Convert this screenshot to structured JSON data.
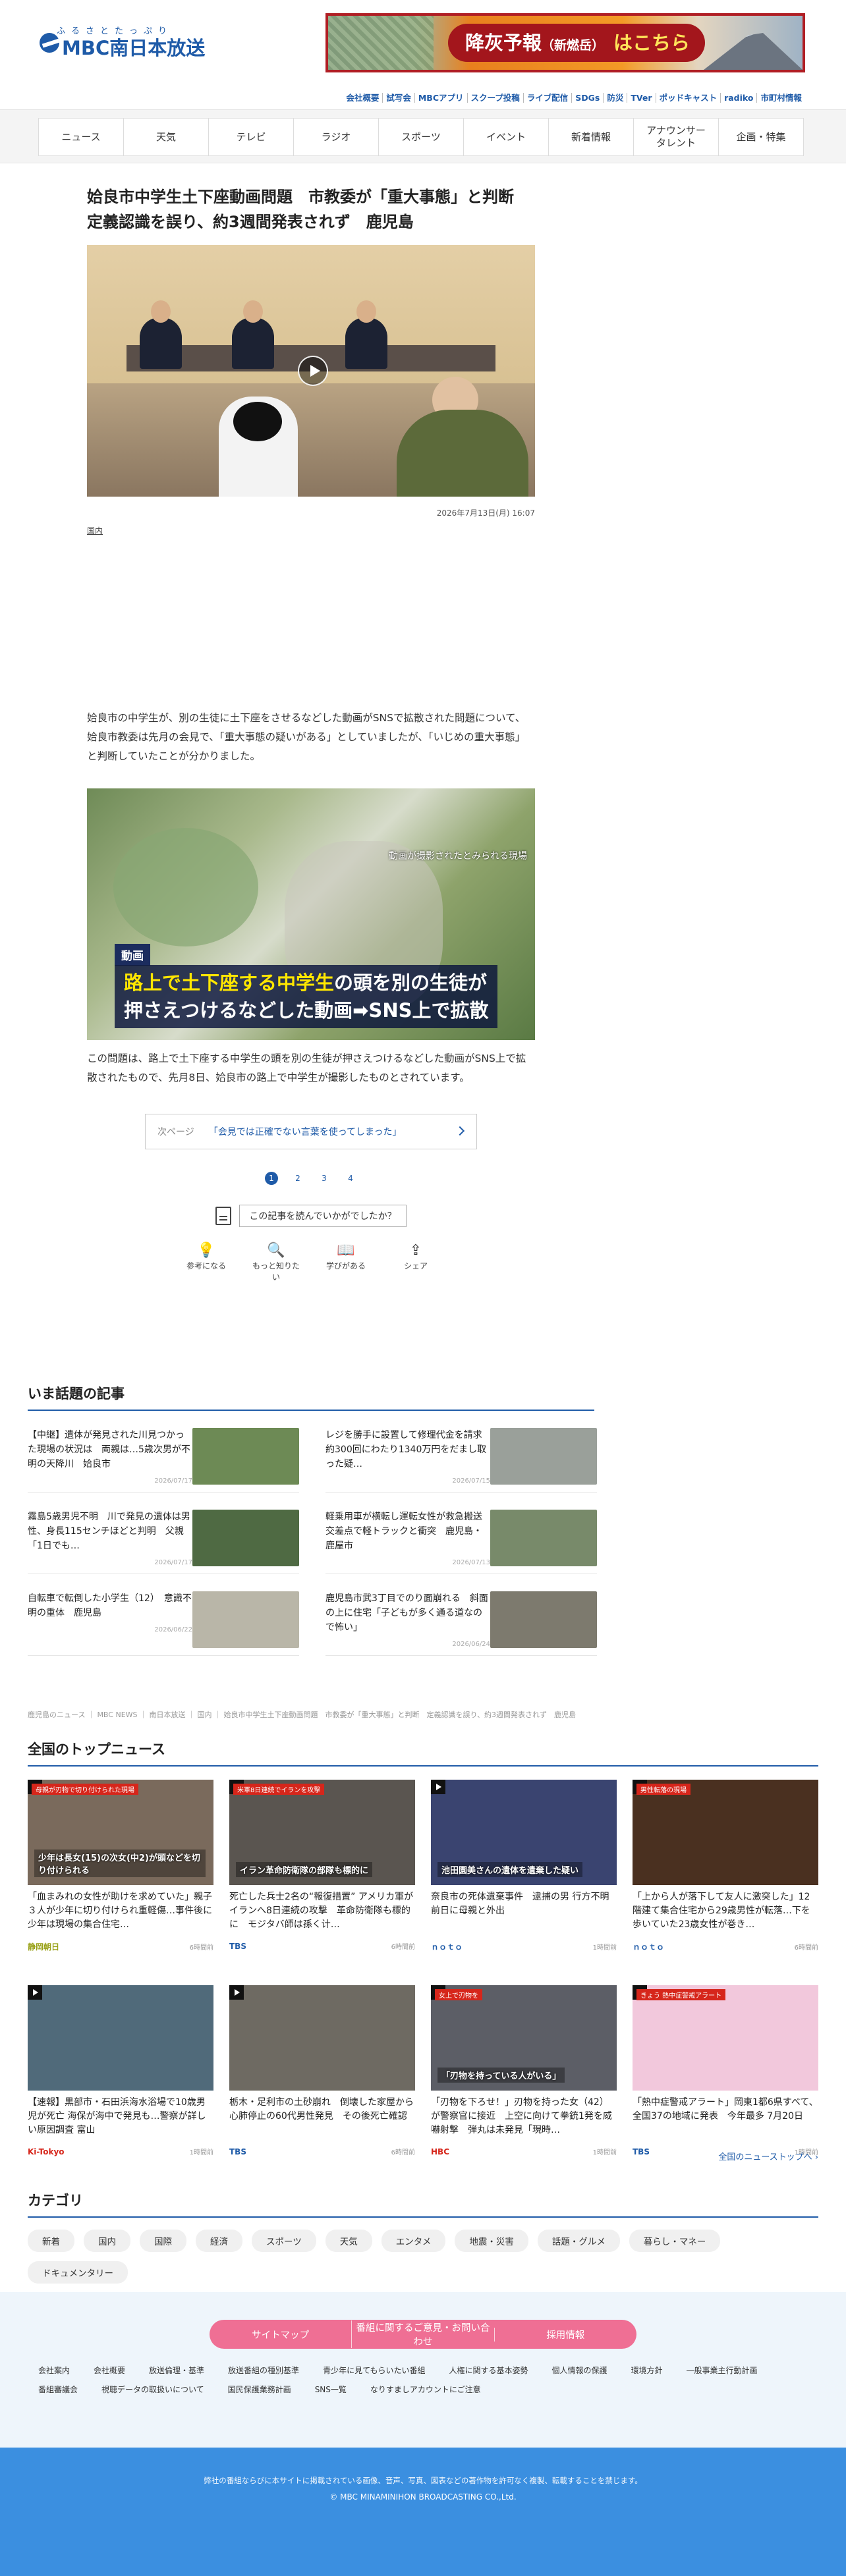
{
  "brand": {
    "kana": "ふるさとたっぷり",
    "name": "MBC南日本放送"
  },
  "ash_banner": {
    "title": "降灰予報",
    "sub": "（新燃岳）",
    "cta": "はこちら"
  },
  "sublinks": [
    "会社概要",
    "試写会",
    "MBCアプリ",
    "スクープ投稿",
    "ライブ配信",
    "SDGs",
    "防災",
    "TVer",
    "ポッドキャスト",
    "radiko",
    "市町村情報"
  ],
  "nav": [
    "ニュース",
    "天気",
    "テレビ",
    "ラジオ",
    "スポーツ",
    "イベント",
    "新着情報",
    "アナウンサー\nタレント",
    "企画・特集"
  ],
  "article": {
    "title": "姶良市中学生土下座動画問題　市教委が「重大事態」と判断　定義認識を誤り、約3週間発表されず　鹿児島",
    "date": "2026年7月13日(月) 16:07",
    "category": "国内",
    "para1": "姶良市の中学生が、別の生徒に土下座をさせるなどした動画がSNSで拡散された問題について、姶良市教委は先月の会見で、「重大事態の疑いがある」としていましたが、「いじめの重大事態」と判断していたことが分かりました。",
    "video2_small": "動画が撮影されたとみられる現場",
    "video2_tag": "動画",
    "video2_line1_hl": "路上で土下座する中学生",
    "video2_line1_rest": "の頭を別の生徒が",
    "video2_line2": "押さえつけるなどした動画➡SNS上で拡散",
    "para2": "この問題は、路上で土下座する中学生の頭を別の生徒が押さえつけるなどした動画がSNS上で拡散されたもので、先月8日、姶良市の路上で中学生が撮影したものとされています。",
    "next_label": "次ページ",
    "next_text": "「会見では正確でない言葉を使ってしまった」",
    "pages": [
      "1",
      "2",
      "3",
      "4"
    ],
    "feedback_q": "この記事を読んでいかがでしたか？",
    "reactions": [
      {
        "icon": "lightbulb-icon",
        "glyph": "💡",
        "label": "参考になる"
      },
      {
        "icon": "search-icon",
        "glyph": "🔍",
        "label": "もっと知りたい"
      },
      {
        "icon": "book-icon",
        "glyph": "📖",
        "label": "学びがある"
      },
      {
        "icon": "share-icon",
        "glyph": "⇪",
        "label": "シェア"
      }
    ]
  },
  "popular": {
    "title": "いま話題の記事",
    "items": [
      {
        "text": "【中継】遺体が発見された川見つかった現場の状況は　両親は…5歳次男が不明の天降川　姶良市",
        "date": "2026/07/17",
        "color": "#6d8a55"
      },
      {
        "text": "レジを勝手に設置して修理代金を請求　約300回にわたり1340万円をだまし取った疑…",
        "date": "2026/07/15",
        "color": "#9aa09a"
      },
      {
        "text": "霧島5歳男児不明　川で発見の遺体は男性、身長115センチほどと判明　父親「1日でも…",
        "date": "2026/07/17",
        "color": "#4f6a43"
      },
      {
        "text": "軽乗用車が横転し運転女性が救急搬送　交差点で軽トラックと衝突　鹿児島・鹿屋市",
        "date": "2026/07/13",
        "color": "#788a6a"
      },
      {
        "text": "自転車で転倒した小学生（12）　意識不明の重体　鹿児島",
        "date": "2026/06/22",
        "color": "#b9b6a8"
      },
      {
        "text": "鹿児島市武3丁目でのり面崩れる　斜面の上に住宅「子どもが多く通る道なので怖い」",
        "date": "2026/06/24",
        "color": "#7d7a6e"
      }
    ]
  },
  "breadcrumb": "鹿児島のニュース ｜ MBC NEWS ｜ 南日本放送 ｜ 国内 ｜ 姶良市中学生土下座動画問題　市教委が「重大事態」と判断　定義認識を誤り、約3週間発表されず　鹿児島",
  "topnews": {
    "title": "全国のトップニュース",
    "all_link": "全国のニューストップへ ›",
    "cards": [
      {
        "headline": "「血まみれの女性が助けを求めていた」親子３人が少年に切り付けられ重軽傷…事件後に少年は現場の集合住宅…",
        "source": "静岡朝日",
        "time": "6時間前",
        "cap": "母親が刃物で切り付けられた現場",
        "cap2": "少年は長女(15)の次女(中2)が頭などを切り付けられる",
        "bg": "#7a6a5c",
        "src_color": "#9aa21a"
      },
      {
        "headline": "死亡した兵士2名の“報復措置” アメリカ軍がイランへ8日連続の攻撃　革命防衛隊も標的に　モジタバ師は孫く计…",
        "source": "TBS",
        "time": "6時間前",
        "cap": "米軍8日連続でイランを攻撃",
        "cap2": "イラン革命防衛隊の部隊も標的に",
        "bg": "#5a5550",
        "src_color": "#1f5ba8"
      },
      {
        "headline": "奈良市の死体遺棄事件　逮捕の男 行方不明前日に母親と外出",
        "source": "ｎｏｔｏ",
        "time": "1時間前",
        "cap": "",
        "cap2": "池田園美さんの遺体を遺棄した疑い",
        "bg": "#3a4470",
        "src_color": "#1f5ba8"
      },
      {
        "headline": "「上から人が落下して友人に激突した」12階建て集合住宅から29歳男性が転落…下を歩いていた23歳女性が巻き…",
        "source": "ｎｏｔｏ",
        "time": "6時間前",
        "cap": "男性転落の現場",
        "cap2": "",
        "bg": "#4a3020",
        "src_color": "#1f5ba8"
      },
      {
        "headline": "【速報】黒部市・石田浜海水浴場で10歳男児が死亡 海保が海中で発見も…警察が詳しい原因調査 富山",
        "source": "Ki-Tokyo",
        "time": "1時間前",
        "cap": "",
        "cap2": "",
        "bg": "#506a7a",
        "src_color": "#d6261b"
      },
      {
        "headline": "栃木・足利市の土砂崩れ　倒壊した家屋から心肺停止の60代男性発見　その後死亡確認",
        "source": "TBS",
        "time": "6時間前",
        "cap": "",
        "cap2": "",
        "bg": "#6e6a62",
        "src_color": "#1f5ba8"
      },
      {
        "headline": "「刃物を下ろせ！」刃物を持った女（42）が警察官に接近　上空に向けて拳銃1発を威嚇射撃　弾丸は未発見「現時…",
        "source": "HBC",
        "time": "1時間前",
        "cap": "女上で刃物を",
        "cap2": "「刃物を持っている人がいる」",
        "bg": "#5c5e66",
        "src_color": "#d6261b"
      },
      {
        "headline": "「熱中症警戒アラート」岡東1都6県すべて、全国37の地域に発表　今年最多 7月20日",
        "source": "TBS",
        "time": "1時間前",
        "cap": "きょう 熱中症警戒アラート",
        "cap2": "",
        "bg": "#f2c8dc",
        "src_color": "#1f5ba8"
      }
    ]
  },
  "categories": {
    "title": "カテゴリ",
    "items": [
      "新着",
      "国内",
      "国際",
      "経済",
      "スポーツ",
      "天気",
      "エンタメ",
      "地震・災害",
      "話題・グルメ",
      "暮らし・マネー",
      "ドキュメンタリー"
    ]
  },
  "footer": {
    "buttons": [
      "サイトマップ",
      "番組に関するご意見・お問い合わせ",
      "採用情報"
    ],
    "links": [
      "会社案内",
      "会社概要",
      "放送倫理・基準",
      "放送番組の種別基準",
      "青少年に見てもらいたい番組",
      "人権に関する基本姿勢",
      "個人情報の保護",
      "環境方針",
      "一般事業主行動計画",
      "番組審議会",
      "視聴データの取扱いについて",
      "国民保護業務計画",
      "SNS一覧",
      "なりすましアカウントにご注意"
    ],
    "notice": "弊社の番組ならびに本サイトに掲載されている画像、音声、写真、図表などの著作物を許可なく複製、転載することを禁じます。",
    "copyright": "© MBC MINAMINIHON BROADCASTING CO.,Ltd."
  }
}
